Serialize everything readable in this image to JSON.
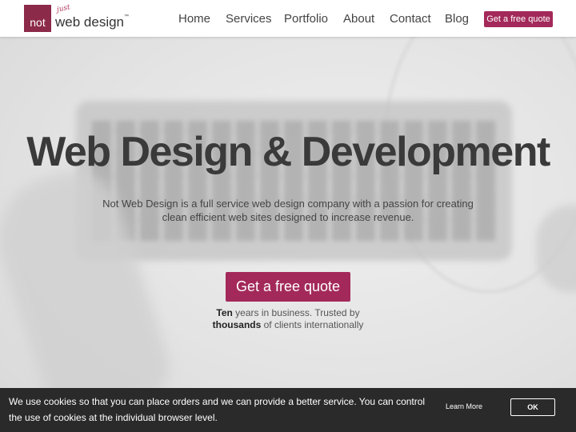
{
  "header": {
    "logo": {
      "box_text": "not",
      "script_text": "just",
      "main_text": "web design",
      "tm": "™"
    },
    "nav": [
      "Home",
      "Services",
      "Portfolio",
      "About",
      "Contact",
      "Blog"
    ],
    "quote_button": "Get a free quote"
  },
  "hero": {
    "title": "Web Design & Development",
    "description": "Not Web Design is a full service web design company with a passion for creating clean efficient web sites designed to increase revenue.",
    "cta_button": "Get a free quote",
    "trust": {
      "years_bold": "Ten",
      "years_rest": " years in business. Trusted by",
      "clients_bold": "thousands",
      "clients_rest": " of clients internationally"
    }
  },
  "cookie_bar": {
    "text": "We use cookies so that you can place orders and we can provide a better service. You can control the use of cookies at the individual browser level.",
    "learn_more": "Learn More",
    "ok": "OK"
  },
  "colors": {
    "brand": "#a3295a",
    "logo_box": "#8c2a4a",
    "cookie_bg": "#2a2a2a"
  }
}
